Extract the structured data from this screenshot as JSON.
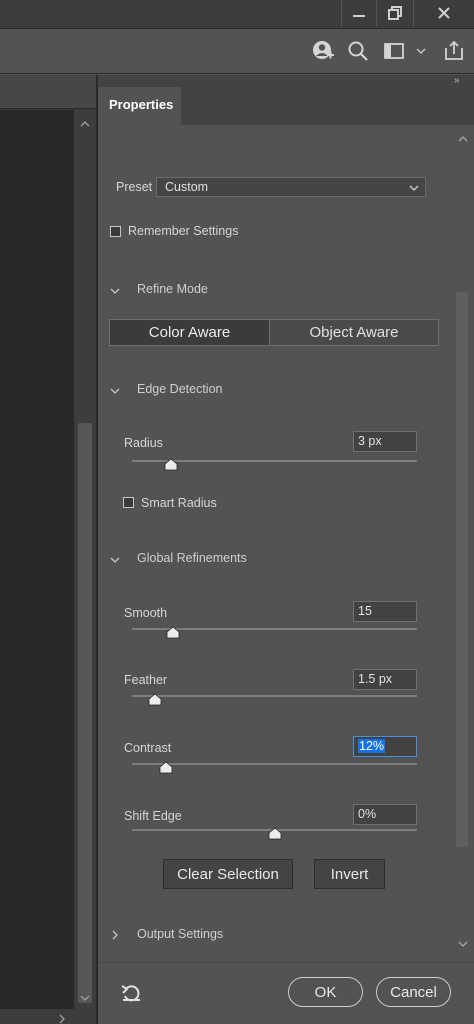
{
  "window": {
    "minimize_icon": "minimize-icon",
    "restore_icon": "restore-icon",
    "close_icon": "close-icon"
  },
  "toolbar": {
    "icons": [
      "user-add-icon",
      "search-icon",
      "workspace-icon",
      "chevron-down-icon",
      "share-icon"
    ]
  },
  "panel": {
    "collapse_glyph": "»",
    "tab": "Properties"
  },
  "preset": {
    "label": "Preset",
    "value": "Custom"
  },
  "remember_settings": {
    "label": "Remember Settings",
    "checked": false
  },
  "refine_mode": {
    "title": "Refine Mode",
    "options": [
      "Color Aware",
      "Object Aware"
    ],
    "selected": "Color Aware"
  },
  "edge_detection": {
    "title": "Edge Detection",
    "radius": {
      "label": "Radius",
      "value": "3 px",
      "level": 0.14
    },
    "smart_radius": {
      "label": "Smart Radius",
      "checked": false
    }
  },
  "global_refinements": {
    "title": "Global Refinements",
    "smooth": {
      "label": "Smooth",
      "value": "15",
      "level": 0.15
    },
    "feather": {
      "label": "Feather",
      "value": "1.5 px",
      "level": 0.08
    },
    "contrast": {
      "label": "Contrast",
      "value": "12%",
      "level": 0.12
    },
    "shift_edge": {
      "label": "Shift Edge",
      "value": "0%",
      "level": 0.5
    }
  },
  "actions": {
    "clear_selection": "Clear Selection",
    "invert": "Invert"
  },
  "output_settings": {
    "title": "Output Settings"
  },
  "footer": {
    "ok": "OK",
    "cancel": "Cancel",
    "reset_icon": "reset-icon"
  },
  "colors": {
    "panel_bg": "#535353",
    "highlight": "#1473e6"
  }
}
